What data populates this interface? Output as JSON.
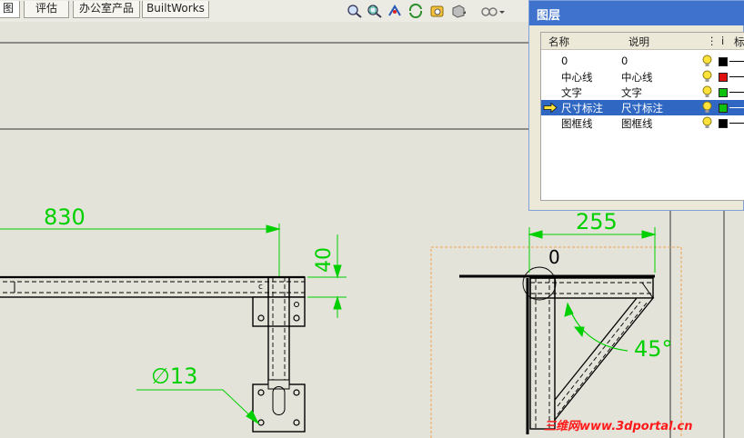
{
  "tabs": [
    "图",
    "评估",
    "办公室产品",
    "BuiltWorks"
  ],
  "toolbar": {
    "icons": [
      "zoom-to-fit-icon",
      "zoom-area-icon",
      "zoom-in-out-icon",
      "rotate-icon",
      "pan-icon",
      "display-style-icon",
      "view-settings-icon"
    ]
  },
  "drawing": {
    "dim_830": "830",
    "dim_40": "40",
    "dim_dia13": "∅13",
    "dim_255": "255",
    "dim_0": "0",
    "dim_45": "45°"
  },
  "layers_panel": {
    "title": "图层",
    "headers": {
      "name": "名称",
      "desc": "说明",
      "col3": "i",
      "col4": "标"
    },
    "rows": [
      {
        "name": "0",
        "desc": "0",
        "color": "#000000",
        "selected": false
      },
      {
        "name": "中心线",
        "desc": "中心线",
        "color": "#e01010",
        "selected": false
      },
      {
        "name": "文字",
        "desc": "文字",
        "color": "#10c010",
        "selected": false
      },
      {
        "name": "尺寸标注",
        "desc": "尺寸标注",
        "color": "#10c010",
        "selected": true
      },
      {
        "name": "图框线",
        "desc": "图框线",
        "color": "#000000",
        "selected": false
      }
    ]
  },
  "colors": {
    "dimension": "#00d000",
    "selection": "#2f67c2",
    "titlebar": "#3f72cc"
  },
  "watermark": "三维网www.3dportal.cn"
}
